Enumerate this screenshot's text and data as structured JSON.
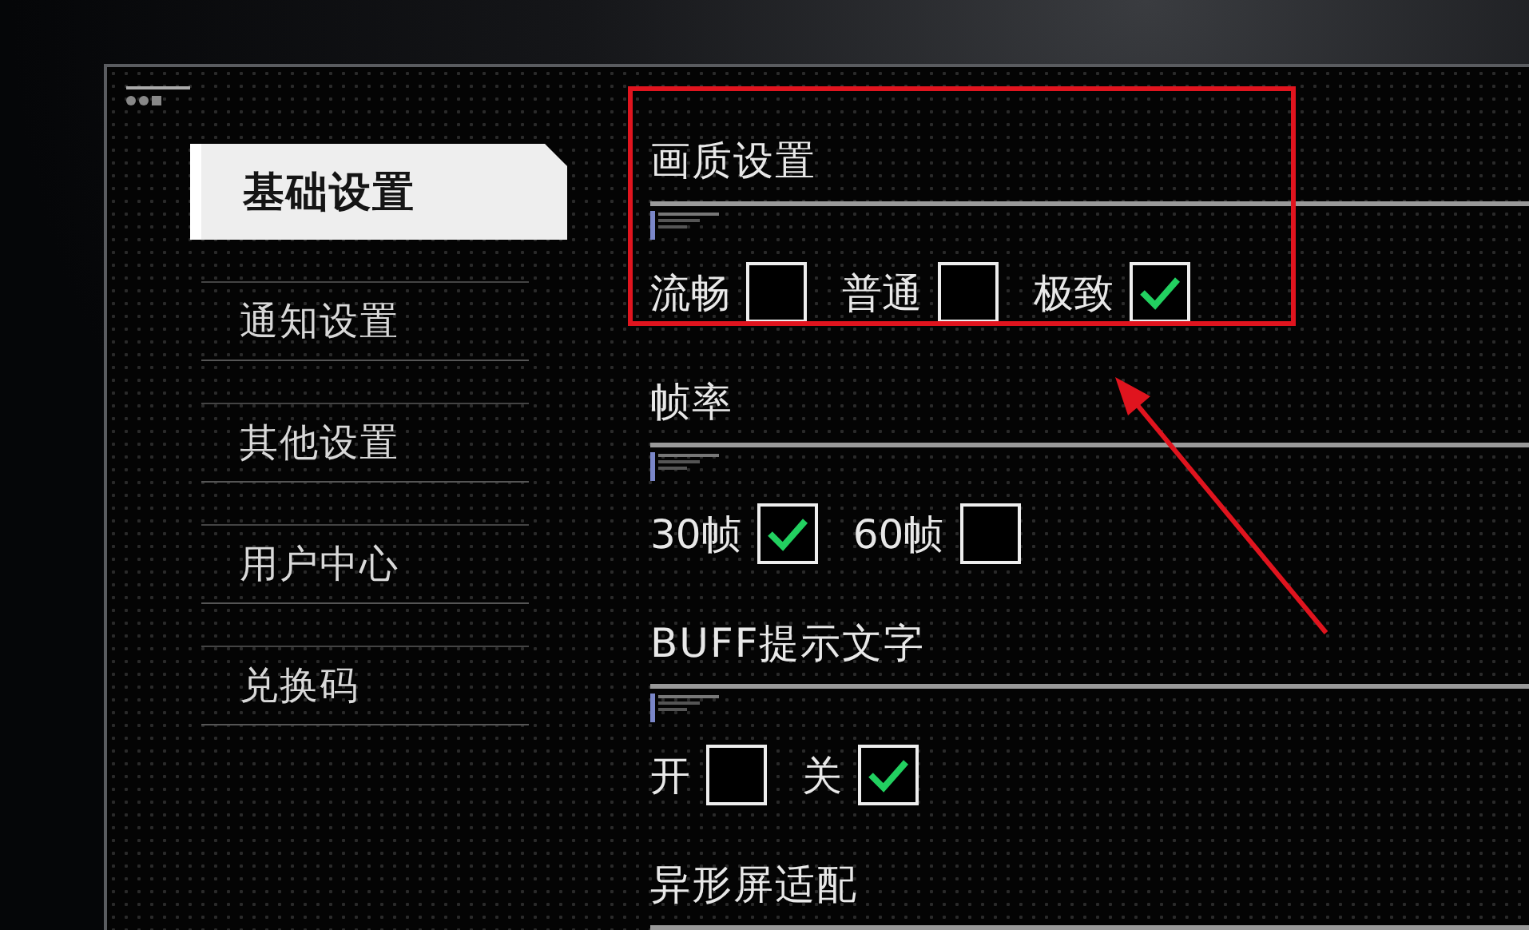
{
  "sidebar": {
    "items": [
      {
        "label": "基础设置",
        "selected": true
      },
      {
        "label": "通知设置",
        "selected": false
      },
      {
        "label": "其他设置",
        "selected": false
      },
      {
        "label": "用户中心",
        "selected": false
      },
      {
        "label": "兑换码",
        "selected": false
      }
    ]
  },
  "sections": [
    {
      "title": "画质设置",
      "highlighted": true,
      "options": [
        {
          "label": "流畅",
          "checked": false
        },
        {
          "label": "普通",
          "checked": false
        },
        {
          "label": "极致",
          "checked": true
        }
      ]
    },
    {
      "title": "帧率",
      "highlighted": false,
      "options": [
        {
          "label": "30帧",
          "checked": true
        },
        {
          "label": "60帧",
          "checked": false
        }
      ]
    },
    {
      "title": "BUFF提示文字",
      "highlighted": false,
      "options": [
        {
          "label": "开",
          "checked": false
        },
        {
          "label": "关",
          "checked": true
        }
      ]
    },
    {
      "title": "异形屏适配",
      "highlighted": false
    }
  ]
}
